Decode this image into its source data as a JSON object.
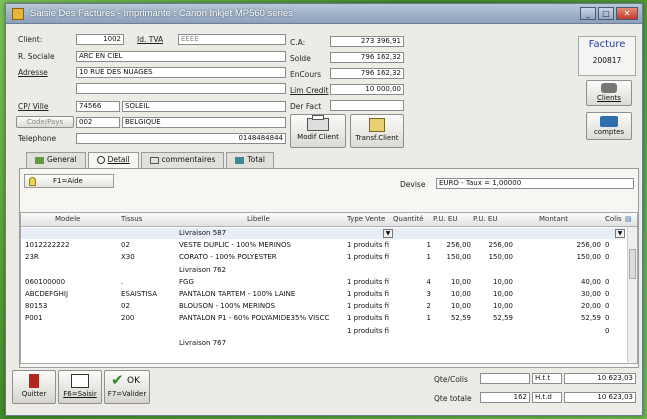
{
  "window": {
    "title": "Saisie Des Factures - Imprimante : Canon Inkjet MP560 series"
  },
  "client": {
    "client_label": "Client:",
    "client_value": "1002",
    "tva_label": "Id. TVA",
    "tva_value": "EEEE",
    "raison_label": "R. Sociale",
    "raison_value": "ARC EN CIEL",
    "adresse_label": "Adresse",
    "adresse_value": "10 RUE DES NUAGES",
    "adresse2_value": "",
    "ville_label": "CP/ Ville",
    "cp_value": "74566",
    "ville_value": "SOLEIL",
    "codepays_label": "Code/Pays",
    "codepays_value": "002",
    "pays_value": "BELGIQUE",
    "tel_label": "Telephone",
    "tel_value": "0148484844"
  },
  "stats": {
    "ca_label": "C.A:",
    "ca_value": "273 396,91",
    "solde_label": "Solde",
    "solde_value": "796 162,32",
    "encours_label": "EnCours",
    "encours_value": "796 162,32",
    "limcredit_label": "Lim Credit",
    "limcredit_value": "10 000,00",
    "derfact_label": "Der Fact",
    "derfact_value": ""
  },
  "buttons": {
    "modif_client": "Modif Client",
    "transf_client": "Transf.Client",
    "clients": "Clients",
    "comptes": "comptes"
  },
  "facture": {
    "title": "Facture",
    "number": "200817"
  },
  "tabs": [
    {
      "label": "General"
    },
    {
      "label": "Detail"
    },
    {
      "label": "commentaires"
    },
    {
      "label": "Total"
    }
  ],
  "detail": {
    "aide_label": "F1=Aide",
    "devise_label": "Devise",
    "devise_value": "EURO - Taux = 1,00000"
  },
  "grid": {
    "headers": [
      "Modele",
      "Tissus",
      "Libelle",
      "Type Vente",
      "Quantité",
      "P.U. EU",
      "P.U. EU",
      "Montant",
      "Colis"
    ],
    "rows": [
      {
        "modele": "",
        "tissus": "",
        "libelle": "Livraison 587",
        "type": "",
        "qte": "",
        "pu1": "",
        "pu2": "",
        "montant": "",
        "colis": ""
      },
      {
        "modele": "1012222222",
        "tissus": "02",
        "libelle": "VESTE DUPLIC - 100% MERINOS",
        "type": "1 produits fi",
        "qte": "1",
        "pu1": "256,00",
        "pu2": "256,00",
        "montant": "256,00",
        "colis": "0"
      },
      {
        "modele": "23R",
        "tissus": "X30",
        "libelle": "CORATO - 100% POLYESTER",
        "type": "1 produits fi",
        "qte": "1",
        "pu1": "150,00",
        "pu2": "150,00",
        "montant": "150,00",
        "colis": "0"
      },
      {
        "modele": "",
        "tissus": "",
        "libelle": "Livraison 762",
        "type": "",
        "qte": "",
        "pu1": "",
        "pu2": "",
        "montant": "",
        "colis": ""
      },
      {
        "modele": "060100000",
        "tissus": ".",
        "libelle": "FGG",
        "type": "1 produits fi",
        "qte": "4",
        "pu1": "10,00",
        "pu2": "10,00",
        "montant": "40,00",
        "colis": "0"
      },
      {
        "modele": "ABCDEFGHIJ",
        "tissus": "ESAISTISA",
        "libelle": "PANTALON TARTEM - 100% LAINE",
        "type": "1 produits fi",
        "qte": "3",
        "pu1": "10,00",
        "pu2": "10,00",
        "montant": "30,00",
        "colis": "0"
      },
      {
        "modele": "80153",
        "tissus": "02",
        "libelle": "BLOUSON - 100% MERINOS",
        "type": "1 produits fi",
        "qte": "2",
        "pu1": "10,00",
        "pu2": "10,00",
        "montant": "20,00",
        "colis": "0"
      },
      {
        "modele": "P001",
        "tissus": "200",
        "libelle": "PANTALON P1 - 60% POLYAMIDE35% VISCC",
        "type": "1 produits fi",
        "qte": "1",
        "pu1": "52,59",
        "pu2": "52,59",
        "montant": "52,59",
        "colis": "0"
      },
      {
        "modele": "",
        "tissus": "",
        "libelle": "",
        "type": "1 produits fi",
        "qte": "",
        "pu1": "",
        "pu2": "",
        "montant": "",
        "colis": "0"
      },
      {
        "modele": "",
        "tissus": "",
        "libelle": "Livraison 767",
        "type": "",
        "qte": "",
        "pu1": "",
        "pu2": "",
        "montant": "",
        "colis": ""
      }
    ]
  },
  "footer": {
    "quitter": "Quitter",
    "saisir": "F6=Saisir",
    "valider": "F7=Valider",
    "ok": "OK",
    "qte_colis_label": "Qte/Colis",
    "qte_colis_value": "",
    "qte_totale_label": "Qte totale",
    "qte_totale_value": "162",
    "htt_label": "H.t.t",
    "htt_value": "10 623,03",
    "htd_label": "H.t.d",
    "htd_value": "10 623,03"
  }
}
